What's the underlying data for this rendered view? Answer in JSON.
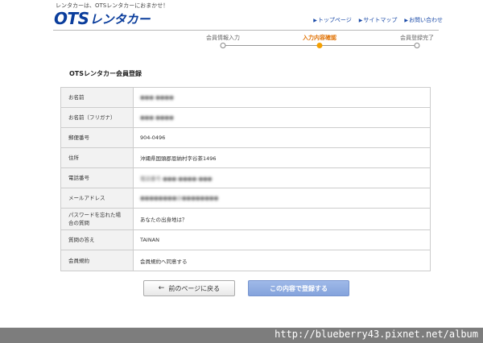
{
  "header": {
    "tagline": "レンタカーは、OTSレンタカーにおまかせ！",
    "logo_ots": "OTS",
    "logo_rent": "レンタカー",
    "nav": [
      {
        "label": "トップページ"
      },
      {
        "label": "サイトマップ"
      },
      {
        "label": "お問い合わせ"
      }
    ]
  },
  "steps": [
    {
      "label": "会員情報入力",
      "active": false
    },
    {
      "label": "入力内容確認",
      "active": true
    },
    {
      "label": "会員登録完了",
      "active": false
    }
  ],
  "form": {
    "title": "OTSレンタカー会員登録",
    "rows": [
      {
        "label": "お名前",
        "value": "●●● ●●●●",
        "redacted": true
      },
      {
        "label": "お名前（フリガナ）",
        "value": "●●● ●●●●",
        "redacted": true
      },
      {
        "label": "郵便番号",
        "value": "904-0496",
        "redacted": false
      },
      {
        "label": "住所",
        "value": "沖縄県国頭郡恩納村字谷茶1496",
        "redacted": false
      },
      {
        "label": "電話番号",
        "value": "電話番号 ●●●-●●●●-●●●",
        "redacted": true
      },
      {
        "label": "メールアドレス",
        "value": "●●●●●●●●@●●●●●●●●",
        "redacted": true
      },
      {
        "label": "パスワードを忘れた場合の質問",
        "value": "あなたの出身地は？",
        "redacted": false
      },
      {
        "label": "質問の答え",
        "value": "TAINAN",
        "redacted": false
      },
      {
        "label": "会員規約",
        "value": "会員規約へ同意する",
        "redacted": false
      }
    ]
  },
  "buttons": {
    "back_label": "前のページに戻る",
    "confirm_label": "この内容で登録する"
  },
  "watermark": "http://blueberry43.pixnet.net/album",
  "colors": {
    "brand": "#0a3d9c",
    "nav_link": "#1a4aa8",
    "step_active": "#f5a000",
    "confirm_button": "#8ba9df"
  }
}
